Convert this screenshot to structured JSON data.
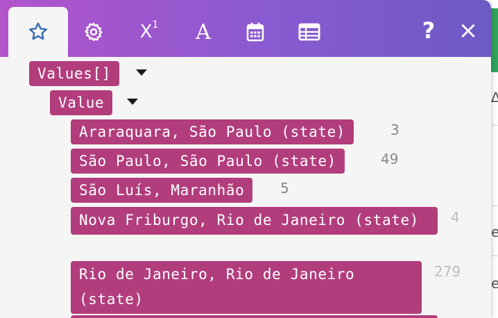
{
  "toolbar": {
    "tools": [
      {
        "name": "star-icon",
        "active": true
      },
      {
        "name": "gear-icon"
      },
      {
        "name": "superscript-icon",
        "glyph": "X",
        "sup": "1"
      },
      {
        "name": "font-icon",
        "glyph": "A"
      },
      {
        "name": "calendar-icon"
      },
      {
        "name": "table-icon"
      }
    ],
    "help_glyph": "?",
    "close_glyph": "×"
  },
  "tree": {
    "root_label": "Values[]",
    "child_label": "Value",
    "items": [
      {
        "label": "Araraquara, São Paulo (state)",
        "count": "3"
      },
      {
        "label": "São Paulo, São Paulo (state)",
        "count": "49"
      },
      {
        "label": "São Luís, Maranhão",
        "count": "5"
      },
      {
        "label": "Nova Friburgo, Rio de Janeiro (state)",
        "count": "4"
      },
      {
        "label": "Rio de Janeiro, Rio de Janeiro (state)",
        "count": "279"
      }
    ]
  },
  "background": {
    "glyphs": [
      "∆",
      "e",
      "e"
    ]
  },
  "colors": {
    "chip": "#b23d7c",
    "toolbar_start": "#b254cc",
    "toolbar_end": "#6d5ac4",
    "active_icon": "#3a6fb0"
  }
}
